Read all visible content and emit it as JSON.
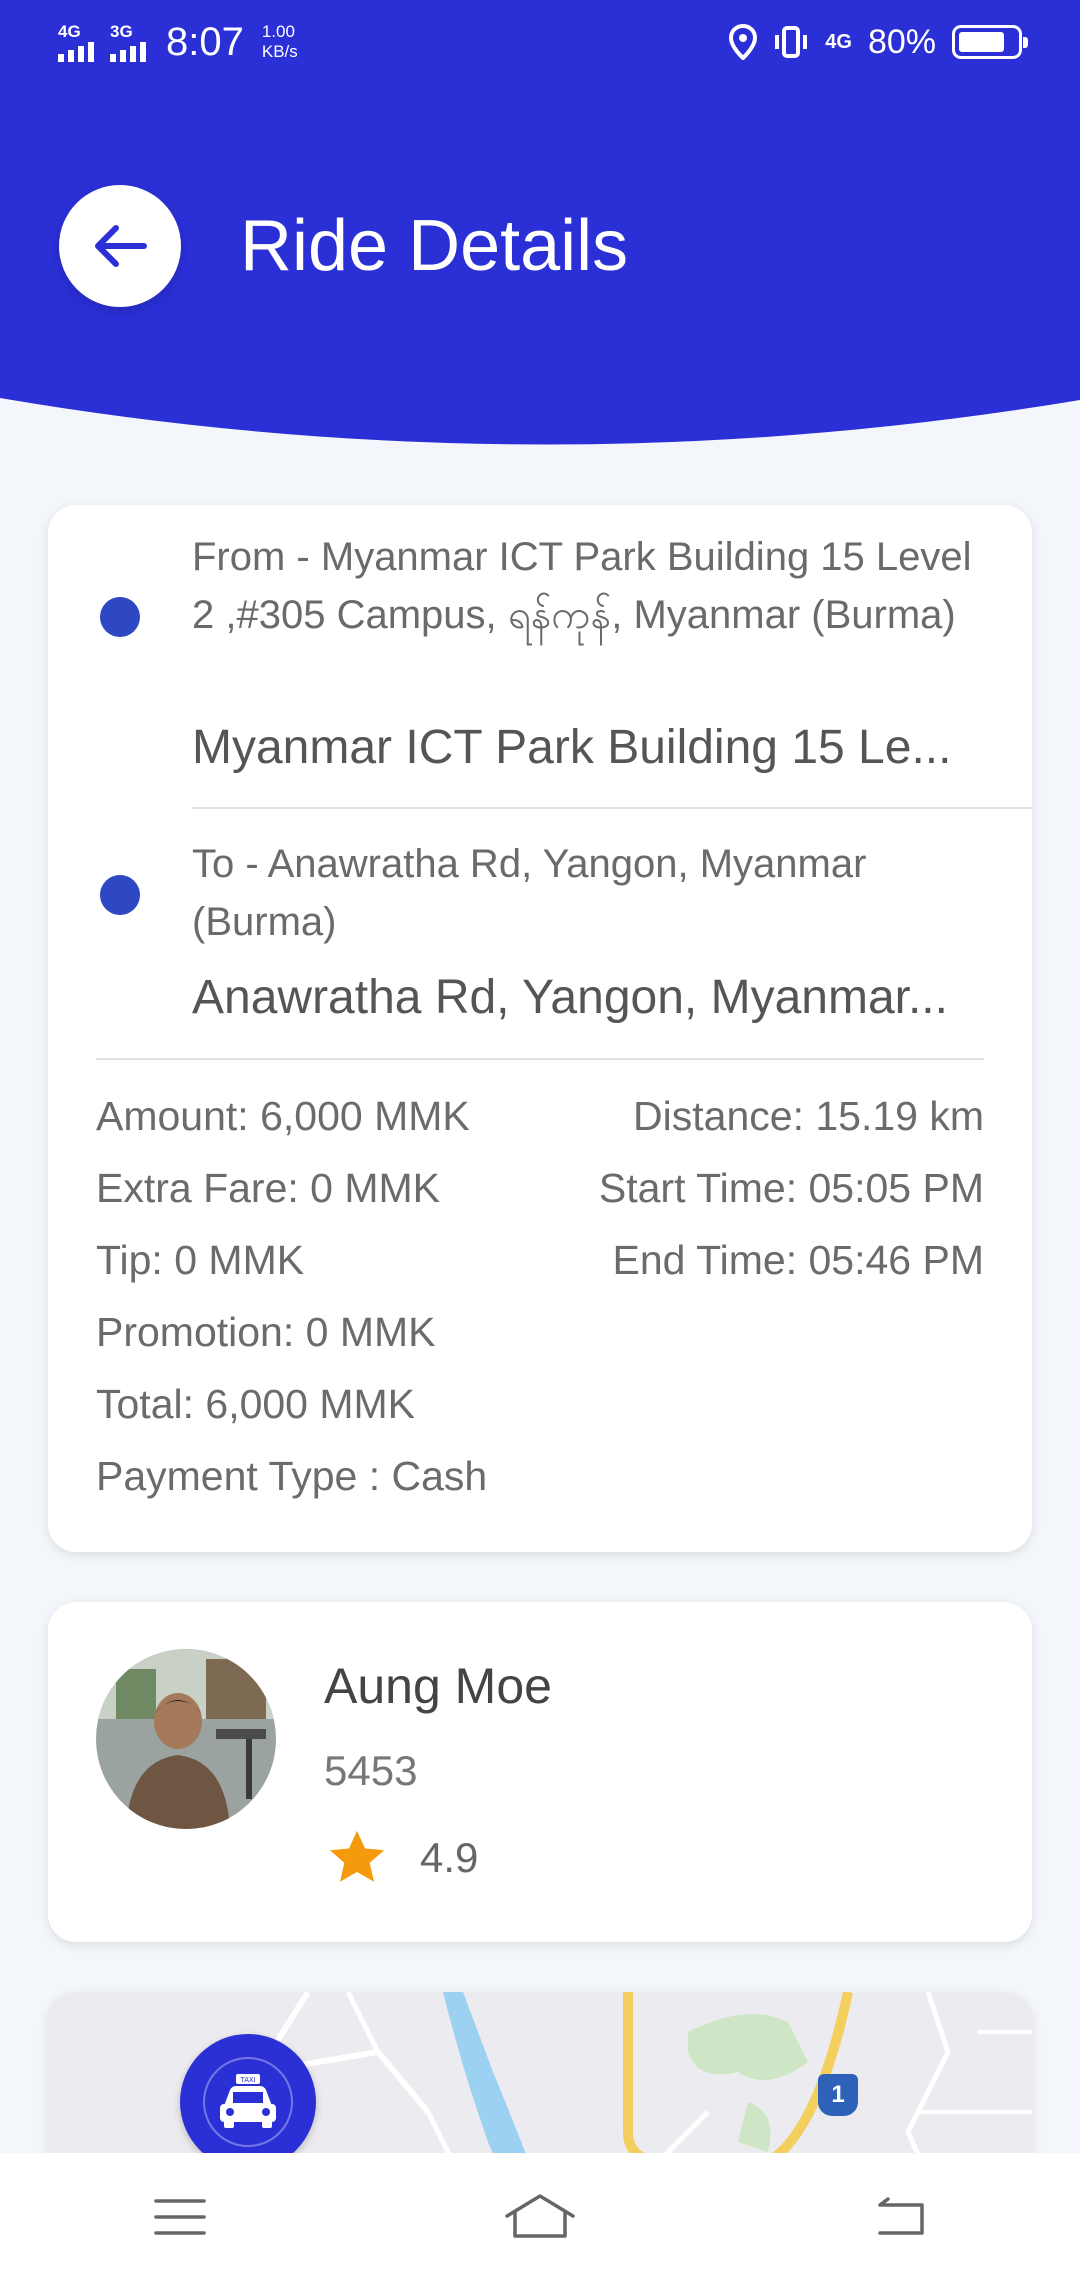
{
  "status_bar": {
    "net1": "4G",
    "net2": "3G",
    "time": "8:07",
    "speed_value": "1.00",
    "speed_unit": "KB/s",
    "net3": "4G",
    "battery": "80%"
  },
  "header": {
    "title": "Ride Details",
    "accent_color": "#2b2fd6"
  },
  "route": {
    "from_full": "From - Myanmar ICT Park Building 15 Level 2 ,#305 Campus, ရန်ကုန်, Myanmar (Burma)",
    "from_short": "Myanmar ICT Park Building 15 Le...",
    "to_full": "To - Anawratha Rd, Yangon, Myanmar (Burma)",
    "to_short": "Anawratha Rd, Yangon, Myanmar..."
  },
  "fare": {
    "amount": "Amount: 6,000 MMK",
    "distance": "Distance: 15.19 km",
    "extra_fare": "Extra Fare: 0 MMK",
    "start_time": "Start Time: 05:05 PM",
    "tip": "Tip: 0 MMK",
    "end_time": "End Time: 05:46 PM",
    "promotion": "Promotion: 0 MMK",
    "total": "Total: 6,000 MMK",
    "payment_type": "Payment Type : Cash"
  },
  "driver": {
    "name": "Aung Moe",
    "id": "5453",
    "rating": "4.9"
  },
  "map": {
    "route_badge": "1",
    "taxi_sign": "TAXI"
  },
  "icons": [
    "back-arrow-icon",
    "location-pin-icon",
    "vibrate-icon",
    "battery-icon",
    "star-icon",
    "taxi-icon",
    "menu-icon",
    "home-icon",
    "back-icon"
  ]
}
